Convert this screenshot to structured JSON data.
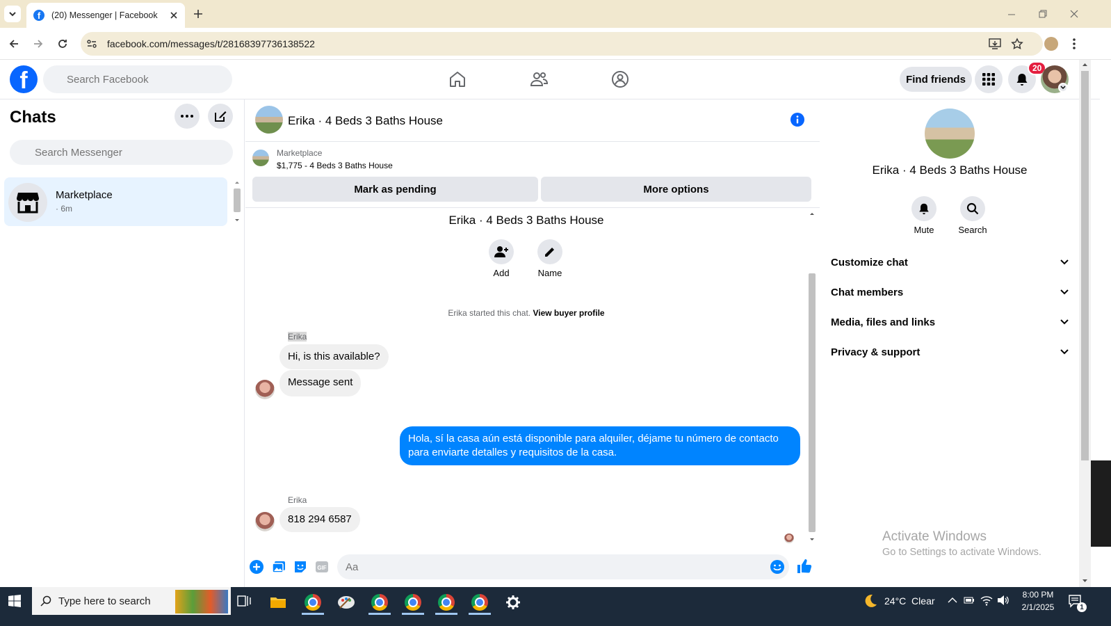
{
  "browser": {
    "tab_title": "(20) Messenger | Facebook",
    "url": "facebook.com/messages/t/28168397736138522"
  },
  "fb_header": {
    "search_placeholder": "Search Facebook",
    "find_friends": "Find friends",
    "notification_count": "20"
  },
  "sidebar": {
    "title": "Chats",
    "search_placeholder": "Search Messenger",
    "chats": [
      {
        "name": "Marketplace",
        "time": "· 6m"
      }
    ]
  },
  "conversation": {
    "title": "Erika · 4 Beds 3 Baths House",
    "marketplace": {
      "label": "Marketplace",
      "listing": "$1,775 - 4 Beds 3 Baths House",
      "mark_pending": "Mark as pending",
      "more_options": "More options"
    },
    "intro": {
      "title": "Erika · 4 Beds 3 Baths House",
      "add_label": "Add",
      "name_label": "Name",
      "started_text": "Erika started this chat.",
      "view_profile": "View buyer profile"
    },
    "messages": [
      {
        "sender": "Erika",
        "text": "Hi, is this available?"
      },
      {
        "sender": "Erika",
        "text": "Message sent"
      },
      {
        "sender": "me",
        "text": "Hola, sí la casa aún está disponible para alquiler, déjame tu número de contacto para enviarte detalles y requisitos de la casa."
      },
      {
        "sender": "Erika",
        "text": "818 294 6587"
      }
    ],
    "composer_placeholder": "Aa"
  },
  "details": {
    "title": "Erika · 4 Beds 3 Baths House",
    "mute_label": "Mute",
    "search_label": "Search",
    "sections": [
      "Customize chat",
      "Chat members",
      "Media, files and links",
      "Privacy & support"
    ]
  },
  "watermark": {
    "line1": "Activate Windows",
    "line2": "Go to Settings to activate Windows."
  },
  "taskbar": {
    "search_placeholder": "Type here to search",
    "weather": "24°C  Clear",
    "time": "8:00 PM",
    "date": "2/1/2025",
    "notification_count": "1"
  },
  "colors": {
    "fb_blue": "#0866ff",
    "bubble_blue": "#0084ff",
    "chrome_tabstrip": "#f1e8cf",
    "taskbar": "#1c2a3a"
  }
}
